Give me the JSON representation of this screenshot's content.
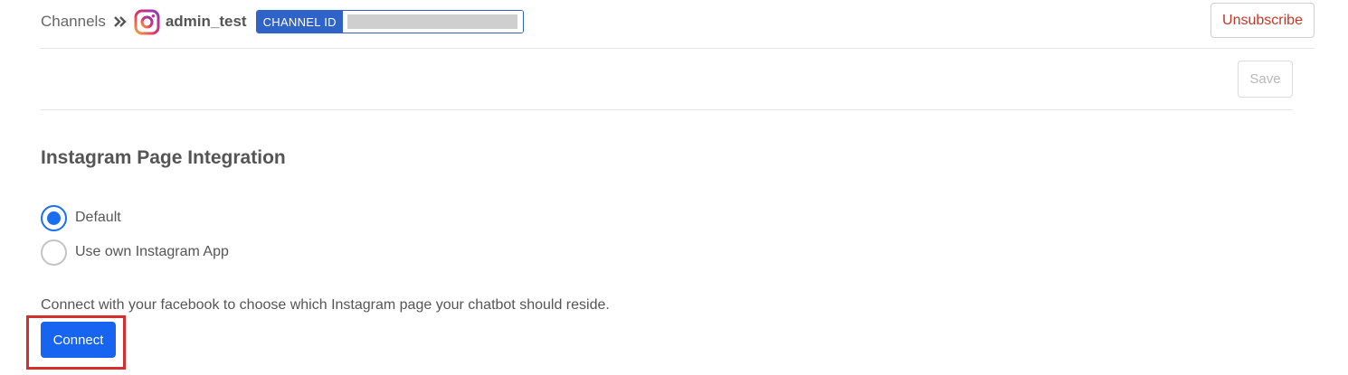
{
  "breadcrumb": {
    "root": "Channels",
    "channel_name": "admin_test",
    "channel_id_label": "CHANNEL ID"
  },
  "header": {
    "unsubscribe_label": "Unsubscribe"
  },
  "toolbar": {
    "save_label": "Save"
  },
  "integration": {
    "title": "Instagram Page Integration",
    "options": [
      {
        "label": "Default",
        "selected": true
      },
      {
        "label": "Use own Instagram App",
        "selected": false
      }
    ],
    "help_text": "Connect with your facebook to choose which Instagram page your chatbot should reside.",
    "connect_label": "Connect"
  },
  "colors": {
    "primary": "#1664f0",
    "danger": "#c0392b",
    "channel_id_badge": "#2f63c8",
    "highlight": "#d32f2f"
  },
  "icons": {
    "separator": "double-chevron-right-icon",
    "channel": "instagram-icon"
  }
}
